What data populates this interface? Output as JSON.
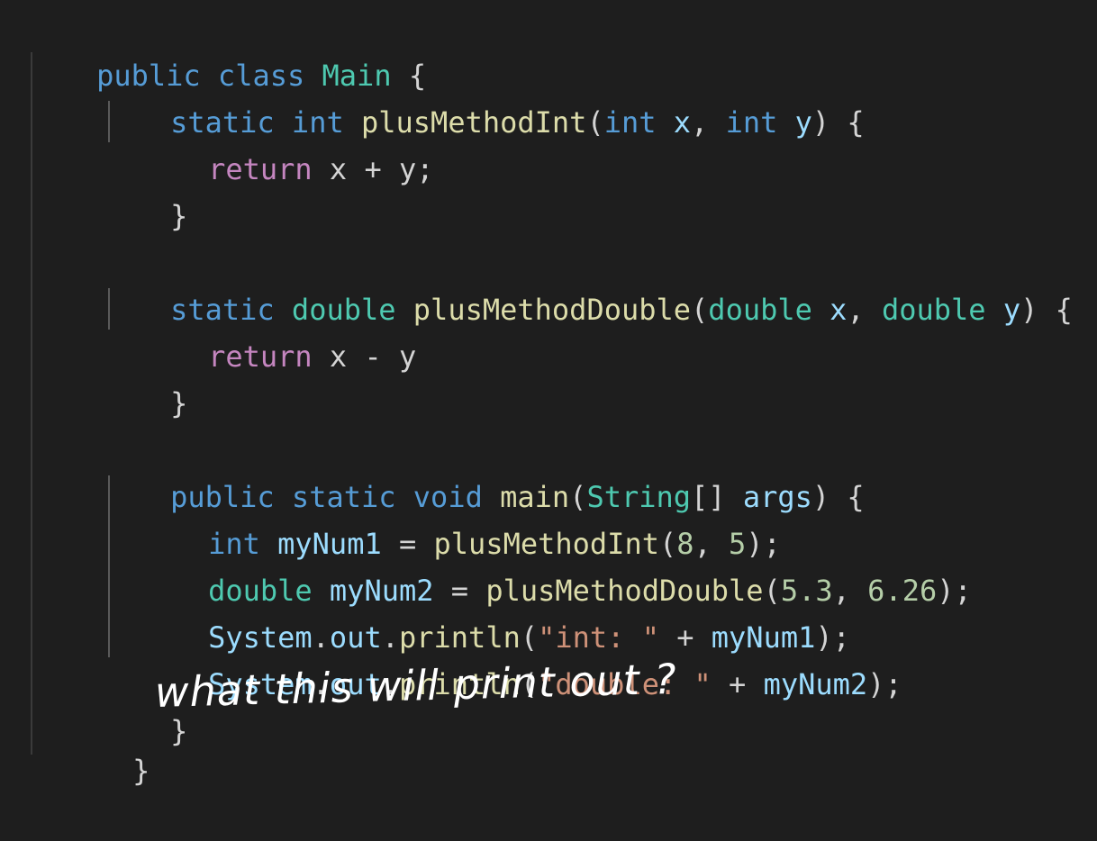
{
  "code": {
    "lines": [
      [
        "public",
        " ",
        "class",
        " ",
        "Main",
        " {"
      ],
      [
        "static",
        " ",
        "int",
        " ",
        "plusMethodInt",
        "(",
        "int",
        " ",
        "x",
        ", ",
        "int",
        " ",
        "y",
        ") {"
      ],
      [
        "return",
        " x + y;"
      ],
      [
        "}"
      ],
      [
        "static",
        " ",
        "double",
        " ",
        "plusMethodDouble",
        "(",
        "double",
        " ",
        "x",
        ", ",
        "double",
        " ",
        "y",
        ") {"
      ],
      [
        "return",
        " x - y"
      ],
      [
        "}"
      ],
      [
        "public",
        " ",
        "static",
        " ",
        "void",
        " ",
        "main",
        "(",
        "String",
        "[] ",
        "args",
        ") {"
      ],
      [
        "int",
        " ",
        "myNum1",
        " = ",
        "plusMethodInt",
        "(",
        "8",
        ", ",
        "5",
        ");"
      ],
      [
        "double",
        " ",
        "myNum2",
        " = ",
        "plusMethodDouble",
        "(",
        "5.3",
        ", ",
        "6.26",
        ");"
      ],
      [
        "System",
        ".",
        "out",
        ".",
        "println",
        "(",
        "\"int: \"",
        " + ",
        "myNum1",
        ");"
      ],
      [
        "System",
        ".",
        "out",
        ".",
        "println",
        "(",
        "\"double: \"",
        " + ",
        "myNum2",
        ");"
      ],
      [
        "}"
      ],
      [
        "}"
      ]
    ]
  },
  "handwritten_note": "what this will print out ?",
  "colors": {
    "background": "#1e1e1e",
    "keyword": "#569cd6",
    "control": "#c586c0",
    "type": "#4ec9b0",
    "function": "#dcdcaa",
    "variable": "#9cdcfe",
    "number": "#b5cea8",
    "string": "#ce9178",
    "text": "#d4d4d4"
  }
}
